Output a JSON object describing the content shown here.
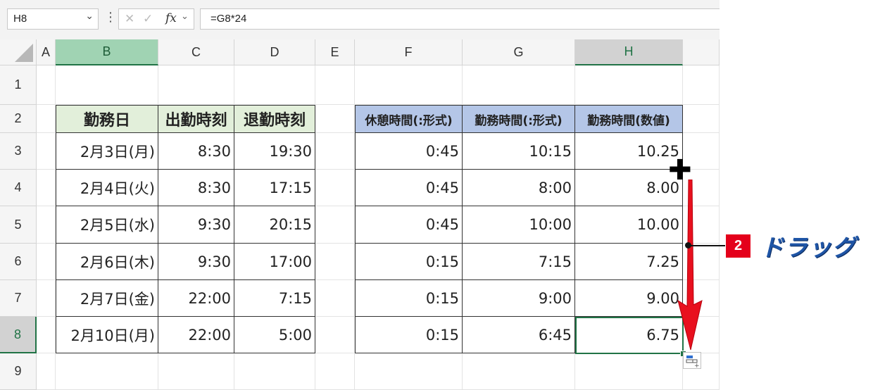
{
  "formula_bar": {
    "name_box": "H8",
    "cancel_icon": "✕",
    "enter_icon": "✓",
    "fx_label": "fx",
    "formula": "=G8*24"
  },
  "columns": [
    "A",
    "B",
    "C",
    "D",
    "E",
    "F",
    "G",
    "H"
  ],
  "rows": [
    "1",
    "2",
    "3",
    "4",
    "5",
    "6",
    "7",
    "8",
    "9"
  ],
  "table_left": {
    "headers": [
      "勤務日",
      "出勤時刻",
      "退勤時刻"
    ],
    "rows": [
      [
        "2月3日(月)",
        "8:30",
        "19:30"
      ],
      [
        "2月4日(火)",
        "8:30",
        "17:15"
      ],
      [
        "2月5日(水)",
        "9:30",
        "20:15"
      ],
      [
        "2月6日(木)",
        "9:30",
        "17:00"
      ],
      [
        "2月7日(金)",
        "22:00",
        "7:15"
      ],
      [
        "2月10日(月)",
        "22:00",
        "5:00"
      ]
    ]
  },
  "table_right": {
    "headers": [
      "休憩時間(:形式)",
      "勤務時間(:形式)",
      "勤務時間(数値)"
    ],
    "rows": [
      [
        "0:45",
        "10:15",
        "10.25"
      ],
      [
        "0:45",
        "8:00",
        "8.00"
      ],
      [
        "0:45",
        "10:00",
        "10.00"
      ],
      [
        "0:15",
        "7:15",
        "7.25"
      ],
      [
        "0:15",
        "9:00",
        "9.00"
      ],
      [
        "0:15",
        "6:45",
        "6.75"
      ]
    ]
  },
  "annotation": {
    "badge": "2",
    "text": "ドラッグ"
  },
  "colors": {
    "accent": "#217346",
    "header_green": "#e2efda",
    "header_blue": "#b4c6e7",
    "badge_red": "#e4001b",
    "arrow_red": "#e8101e",
    "callout_blue": "#1f55a6"
  }
}
